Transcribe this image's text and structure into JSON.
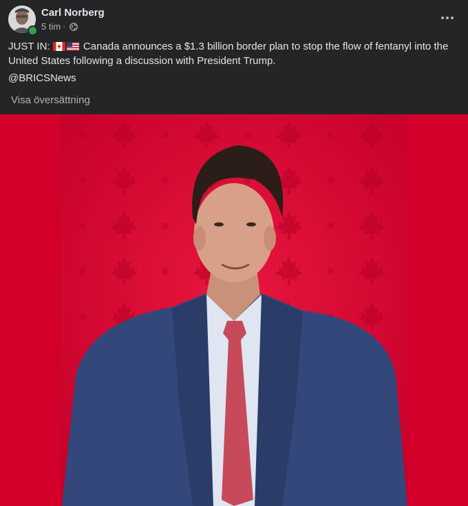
{
  "post": {
    "author": "Carl Norberg",
    "time": "5 tim",
    "separator": "·",
    "text_prefix": "JUST IN:",
    "text_body": "Canada announces a $1.3 billion border plan to stop the flow of fentanyl into the United States following a discussion with President Trump.",
    "mention": "@BRICSNews",
    "translate_label": "Visa översättning"
  },
  "icons": {
    "privacy": "globe-icon",
    "more": "more-horizontal-icon",
    "flags": [
      "canada-flag",
      "usa-flag"
    ]
  },
  "colors": {
    "background": "#242526",
    "text": "#e4e6eb",
    "secondary_text": "#b0b3b8",
    "online": "#31a24c",
    "photo_red": "#d4002c"
  }
}
